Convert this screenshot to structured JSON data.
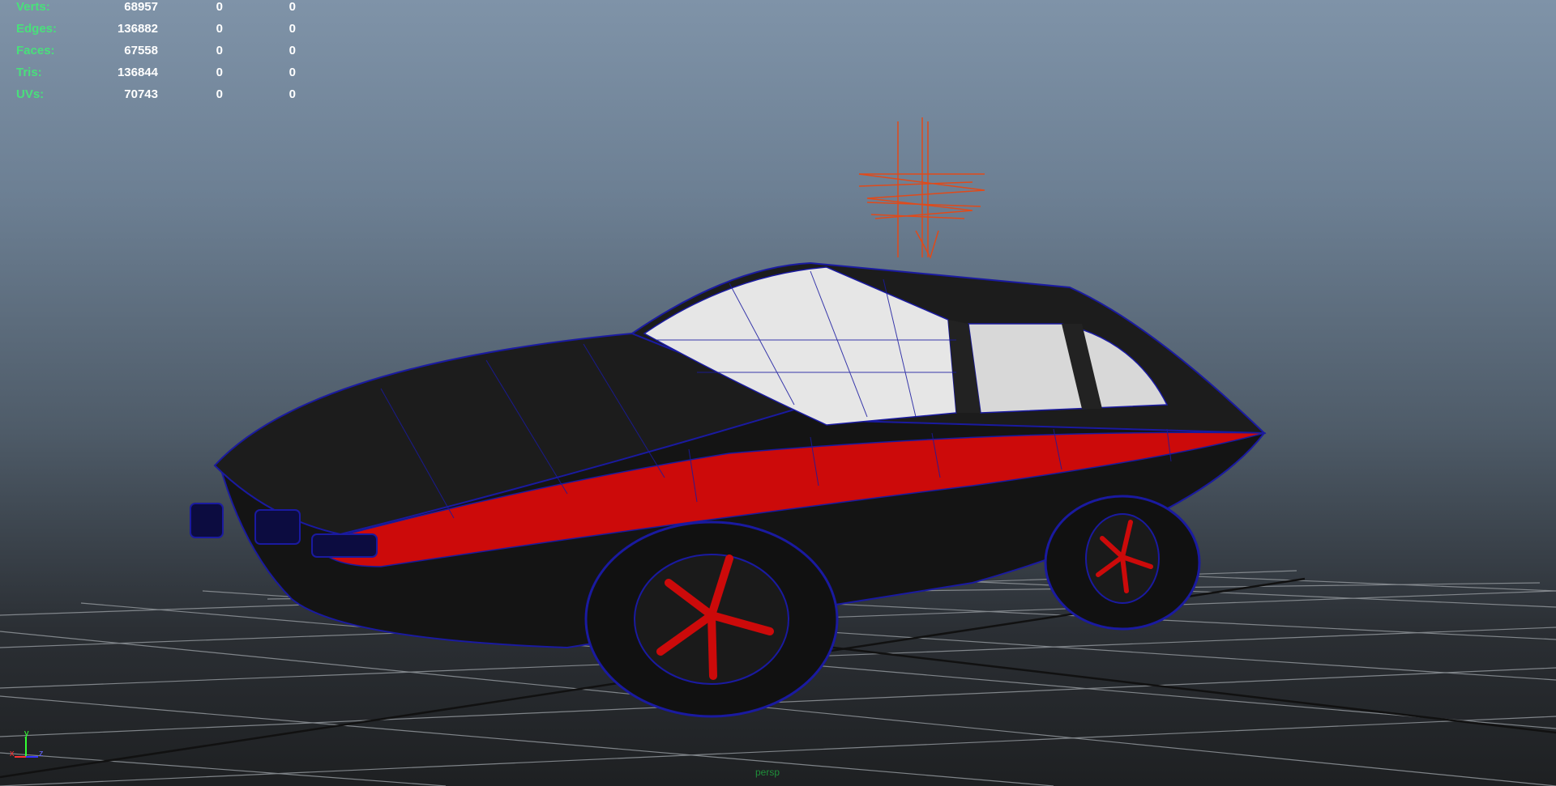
{
  "hud": {
    "rows": [
      {
        "label": "Verts:",
        "v1": "68957",
        "v2": "0",
        "v3": "0"
      },
      {
        "label": "Edges:",
        "v1": "136882",
        "v2": "0",
        "v3": "0"
      },
      {
        "label": "Faces:",
        "v1": "67558",
        "v2": "0",
        "v3": "0"
      },
      {
        "label": "Tris:",
        "v1": "136844",
        "v2": "0",
        "v3": "0"
      },
      {
        "label": "UVs:",
        "v1": "70743",
        "v2": "0",
        "v3": "0"
      }
    ]
  },
  "axis": {
    "x": "x",
    "y": "y",
    "z": "z"
  },
  "camera_label": "persp",
  "colors": {
    "body_black": "#1a1a1a",
    "stripe_red": "#cc0a0a",
    "glass_white": "#e8e8e8",
    "wire_blue": "#1a1aa0",
    "light_icon": "#e04a1a",
    "hud_green": "#49e07b"
  },
  "icons": [
    "light-icon",
    "axis-gizmo-icon"
  ]
}
